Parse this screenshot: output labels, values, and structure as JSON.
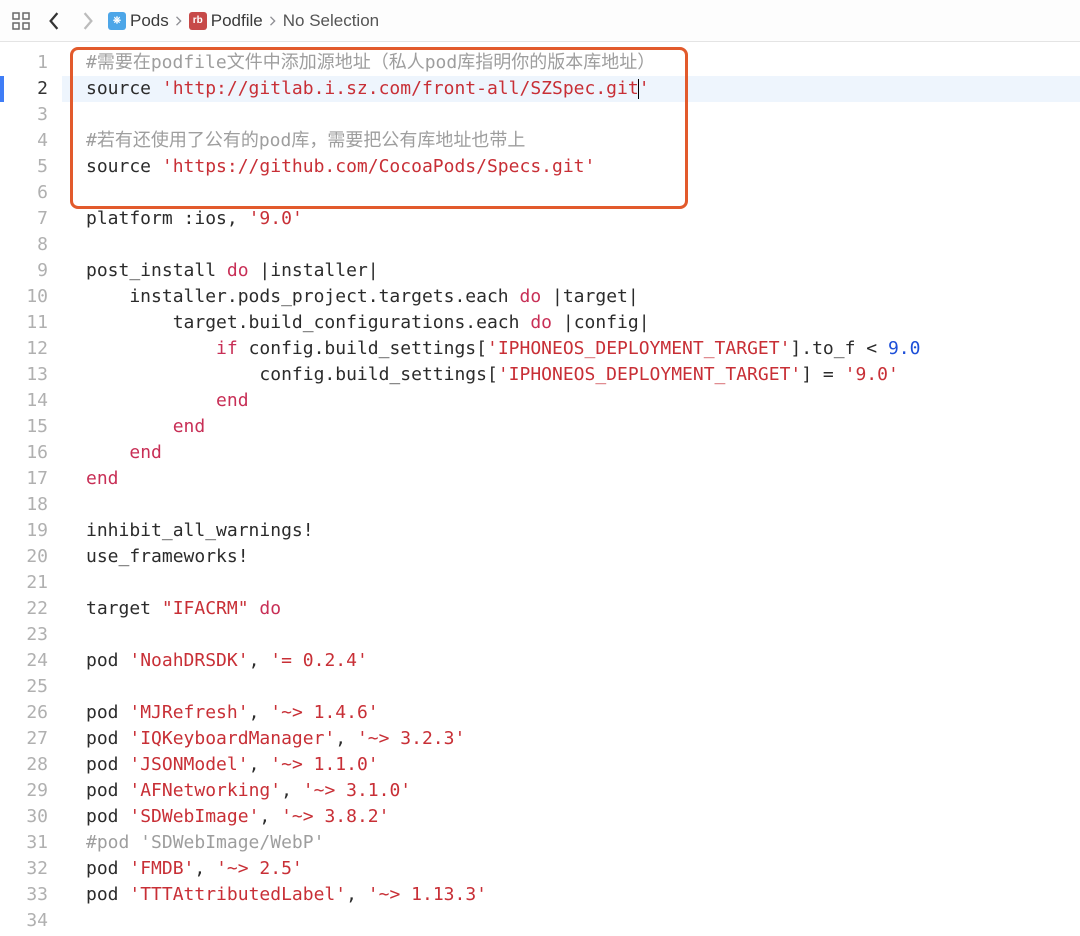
{
  "breadcrumb": {
    "item1": "Pods",
    "item2": "Podfile",
    "item3": "No Selection"
  },
  "icons": {
    "pods_badge": "⎈",
    "rb_badge": "rb"
  },
  "code": {
    "lines": {
      "l1": {
        "full": "#需要在podfile文件中添加源地址（私人pod库指明你的版本库地址）"
      },
      "l2": {
        "a": "source ",
        "b": "'http://gitlab.i.sz.com/front-all/SZSpec.git",
        "c": "'"
      },
      "l3": {
        "full": ""
      },
      "l4": {
        "full": "#若有还使用了公有的pod库，需要把公有库地址也带上"
      },
      "l5": {
        "a": "source ",
        "b": "'https://github.com/CocoaPods/Specs.git'"
      },
      "l6": {
        "full": ""
      },
      "l7": {
        "a": "platform ",
        "b": ":ios",
        "c": ", ",
        "d": "'9.0'"
      },
      "l8": {
        "full": ""
      },
      "l9": {
        "a": "post_install ",
        "b": "do",
        "c": " |installer|"
      },
      "l10": {
        "a": "    installer.pods_project.targets.each ",
        "b": "do",
        "c": " |target|"
      },
      "l11": {
        "a": "        target.build_configurations.each ",
        "b": "do",
        "c": " |config|"
      },
      "l12": {
        "a": "            ",
        "b": "if",
        "c": " config.build_settings[",
        "d": "'IPHONEOS_DEPLOYMENT_TARGET'",
        "e": "].to_f < ",
        "f": "9.0"
      },
      "l13": {
        "a": "                config.build_settings[",
        "b": "'IPHONEOS_DEPLOYMENT_TARGET'",
        "c": "] = ",
        "d": "'9.0'"
      },
      "l14": {
        "a": "            ",
        "b": "end"
      },
      "l15": {
        "a": "        ",
        "b": "end"
      },
      "l16": {
        "a": "    ",
        "b": "end"
      },
      "l17": {
        "a": "",
        "b": "end"
      },
      "l18": {
        "full": ""
      },
      "l19": {
        "a": "inhibit_all_warnings!"
      },
      "l20": {
        "a": "use_frameworks!"
      },
      "l21": {
        "full": ""
      },
      "l22": {
        "a": "target ",
        "b": "\"IFACRM\"",
        "c": " ",
        "d": "do"
      },
      "l23": {
        "full": ""
      },
      "l24": {
        "a": "pod ",
        "b": "'NoahDRSDK'",
        "c": ", ",
        "d": "'= 0.2.4'"
      },
      "l25": {
        "full": ""
      },
      "l26": {
        "a": "pod ",
        "b": "'MJRefresh'",
        "c": ", ",
        "d": "'~> 1.4.6'"
      },
      "l27": {
        "a": "pod ",
        "b": "'IQKeyboardManager'",
        "c": ", ",
        "d": "'~> 3.2.3'"
      },
      "l28": {
        "a": "pod ",
        "b": "'JSONModel'",
        "c": ", ",
        "d": "'~> 1.1.0'"
      },
      "l29": {
        "a": "pod ",
        "b": "'AFNetworking'",
        "c": ", ",
        "d": "'~> 3.1.0'"
      },
      "l30": {
        "a": "pod ",
        "b": "'SDWebImage'",
        "c": ", ",
        "d": "'~> 3.8.2'"
      },
      "l31": {
        "a": "#pod 'SDWebImage/WebP'"
      },
      "l32": {
        "a": "pod ",
        "b": "'FMDB'",
        "c": ", ",
        "d": "'~> 2.5'"
      },
      "l33": {
        "a": "pod ",
        "b": "'TTTAttributedLabel'",
        "c": ", ",
        "d": "'~> 1.13.3'"
      },
      "l34": {
        "full": ""
      }
    }
  },
  "gutter": {
    "n1": "1",
    "n2": "2",
    "n3": "3",
    "n4": "4",
    "n5": "5",
    "n6": "6",
    "n7": "7",
    "n8": "8",
    "n9": "9",
    "n10": "10",
    "n11": "11",
    "n12": "12",
    "n13": "13",
    "n14": "14",
    "n15": "15",
    "n16": "16",
    "n17": "17",
    "n18": "18",
    "n19": "19",
    "n20": "20",
    "n21": "21",
    "n22": "22",
    "n23": "23",
    "n24": "24",
    "n25": "25",
    "n26": "26",
    "n27": "27",
    "n28": "28",
    "n29": "29",
    "n30": "30",
    "n31": "31",
    "n32": "32",
    "n33": "33",
    "n34": "34"
  }
}
